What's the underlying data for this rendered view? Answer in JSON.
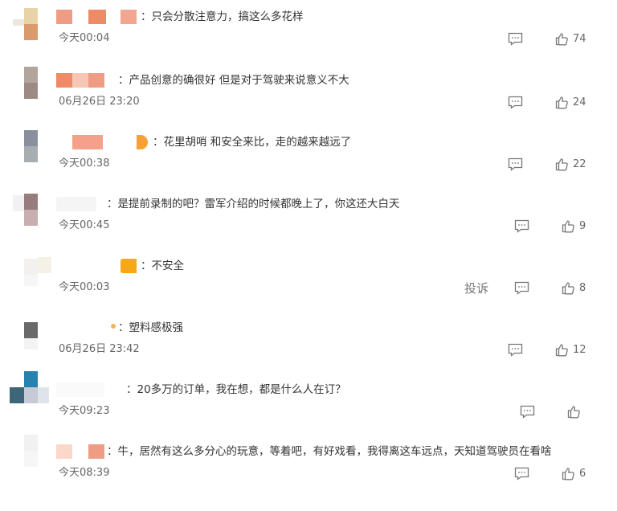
{
  "comments": [
    {
      "text": "：只会分散注意力，搞这么多花样",
      "time": "今天00:04",
      "likes": "74"
    },
    {
      "text": "：产品创意的确很好 但是对于驾驶来说意义不大",
      "time": "06月26日 23:20",
      "likes": "24"
    },
    {
      "text": "：花里胡哨 和安全来比，走的越来越远了",
      "time": "今天00:38",
      "likes": "22"
    },
    {
      "text": "：是提前录制的吧？雷军介绍的时候都晚上了，你这还大白天",
      "time": "今天00:45",
      "likes": "9"
    },
    {
      "text": "：不安全",
      "time": "今天00:03",
      "likes": "8",
      "report_label": "投诉"
    },
    {
      "text": "：塑料感极强",
      "time": "06月26日 23:42",
      "likes": "12"
    },
    {
      "text": "：20多万的订单，我在想，都是什么人在订？",
      "time": "今天09:23",
      "likes": ""
    },
    {
      "text": "：牛，居然有这么多分心的玩意，等着吧，有好戏看，我得离这车远点，天知道驾驶员在看啥",
      "time": "今天08:39",
      "likes": "6"
    }
  ],
  "icons": {
    "comment": "comment-icon",
    "like": "thumbs-up-icon"
  },
  "colors": {
    "muted_text": "#666666",
    "icon": "#777777"
  }
}
